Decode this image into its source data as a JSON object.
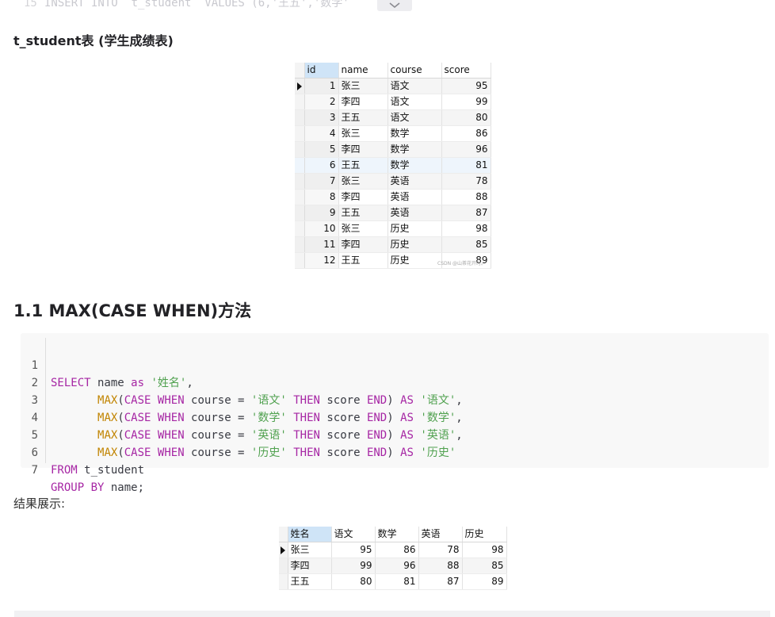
{
  "top_fragment": {
    "line_no": "15",
    "text": "INSERT INTO `t_student` VALUES (6,'王五','数学'"
  },
  "headings": {
    "table_title": "t_student表 (学生成绩表)",
    "section": "1.1 MAX(CASE WHEN)方法",
    "result": "结果展示:"
  },
  "student_table": {
    "headers": [
      "id",
      "name",
      "course",
      "score"
    ],
    "rows": [
      [
        "1",
        "张三",
        "语文",
        "95"
      ],
      [
        "2",
        "李四",
        "语文",
        "99"
      ],
      [
        "3",
        "王五",
        "语文",
        "80"
      ],
      [
        "4",
        "张三",
        "数学",
        "86"
      ],
      [
        "5",
        "李四",
        "数学",
        "96"
      ],
      [
        "6",
        "王五",
        "数学",
        "81"
      ],
      [
        "7",
        "张三",
        "英语",
        "78"
      ],
      [
        "8",
        "李四",
        "英语",
        "88"
      ],
      [
        "9",
        "王五",
        "英语",
        "87"
      ],
      [
        "10",
        "张三",
        "历史",
        "98"
      ],
      [
        "11",
        "李四",
        "历史",
        "85"
      ],
      [
        "12",
        "王五",
        "历史",
        "89"
      ]
    ],
    "watermark": "CSDN @山茶花开时。"
  },
  "code": {
    "line_numbers": [
      "1",
      "2",
      "3",
      "4",
      "5",
      "6",
      "7"
    ]
  },
  "result_table": {
    "headers": [
      "姓名",
      "语文",
      "数学",
      "英语",
      "历史"
    ],
    "rows": [
      [
        "张三",
        "95",
        "86",
        "78",
        "98"
      ],
      [
        "李四",
        "99",
        "96",
        "88",
        "85"
      ],
      [
        "王五",
        "80",
        "81",
        "87",
        "89"
      ]
    ]
  },
  "colors": {
    "keyword": "#a626a4",
    "function": "#c18401",
    "string": "#50a14f",
    "header_selected": "#cfe4f7"
  }
}
